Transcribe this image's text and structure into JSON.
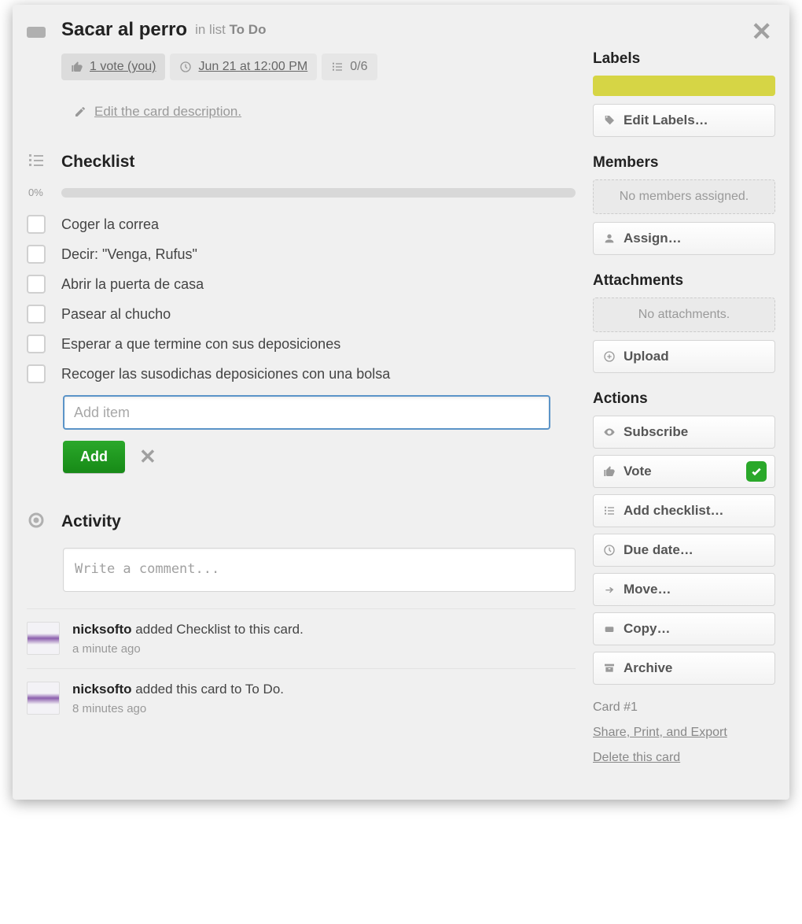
{
  "header": {
    "title": "Sacar al perro",
    "in_list_prefix": "in list",
    "list_name": "To Do"
  },
  "badges": {
    "votes": "1 vote (you)",
    "due": "Jun 21 at 12:00 PM",
    "checklist": "0/6"
  },
  "description": {
    "edit_label": "Edit the card description."
  },
  "checklist": {
    "title": "Checklist",
    "progress_pct": "0%",
    "items": [
      "Coger la correa",
      "Decir: \"Venga, Rufus\"",
      "Abrir la puerta de casa",
      "Pasear al chucho",
      "Esperar a que termine con sus deposiciones",
      "Recoger las susodichas deposiciones con una bolsa"
    ],
    "add_placeholder": "Add item",
    "add_btn": "Add"
  },
  "activity": {
    "title": "Activity",
    "comment_placeholder": "Write a comment...",
    "items": [
      {
        "user": "nicksofto",
        "text": "added Checklist to this card.",
        "when": "a minute ago"
      },
      {
        "user": "nicksofto",
        "text": "added this card to To Do.",
        "when": "8 minutes ago"
      }
    ]
  },
  "sidebar": {
    "labels": {
      "title": "Labels",
      "edit_btn": "Edit Labels…",
      "colors": [
        "#d6d545"
      ]
    },
    "members": {
      "title": "Members",
      "none": "No members assigned.",
      "assign_btn": "Assign…"
    },
    "attachments": {
      "title": "Attachments",
      "none": "No attachments.",
      "upload_btn": "Upload"
    },
    "actions": {
      "title": "Actions",
      "subscribe": "Subscribe",
      "vote": "Vote",
      "add_checklist": "Add checklist…",
      "due_date": "Due date…",
      "move": "Move…",
      "copy": "Copy…",
      "archive": "Archive"
    },
    "meta": {
      "card_number": "Card #1",
      "share": "Share, Print, and Export",
      "delete": "Delete this card"
    }
  }
}
